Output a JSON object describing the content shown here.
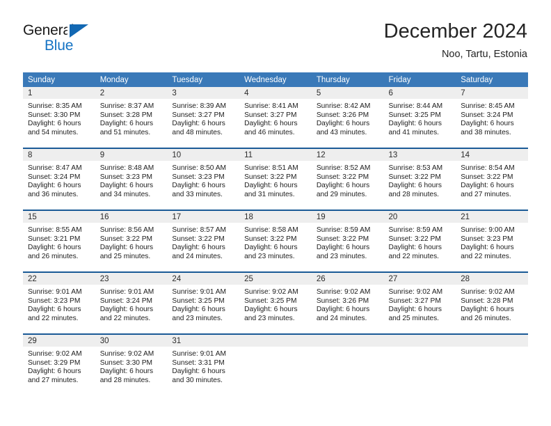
{
  "brand": {
    "name_top": "General",
    "name_bottom": "Blue",
    "color_dark": "#1a1a1a",
    "color_blue": "#1573c4"
  },
  "header": {
    "title": "December 2024",
    "location": "Noo, Tartu, Estonia"
  },
  "theme": {
    "header_row_bg": "#3a79b8",
    "header_row_text": "#ffffff",
    "week_separator": "#1a5a96",
    "daynum_band_bg": "#eeeeee"
  },
  "weekday_headers": [
    "Sunday",
    "Monday",
    "Tuesday",
    "Wednesday",
    "Thursday",
    "Friday",
    "Saturday"
  ],
  "weeks": [
    [
      {
        "day": "1",
        "sunrise": "Sunrise: 8:35 AM",
        "sunset": "Sunset: 3:30 PM",
        "daylight_1": "Daylight: 6 hours",
        "daylight_2": "and 54 minutes."
      },
      {
        "day": "2",
        "sunrise": "Sunrise: 8:37 AM",
        "sunset": "Sunset: 3:28 PM",
        "daylight_1": "Daylight: 6 hours",
        "daylight_2": "and 51 minutes."
      },
      {
        "day": "3",
        "sunrise": "Sunrise: 8:39 AM",
        "sunset": "Sunset: 3:27 PM",
        "daylight_1": "Daylight: 6 hours",
        "daylight_2": "and 48 minutes."
      },
      {
        "day": "4",
        "sunrise": "Sunrise: 8:41 AM",
        "sunset": "Sunset: 3:27 PM",
        "daylight_1": "Daylight: 6 hours",
        "daylight_2": "and 46 minutes."
      },
      {
        "day": "5",
        "sunrise": "Sunrise: 8:42 AM",
        "sunset": "Sunset: 3:26 PM",
        "daylight_1": "Daylight: 6 hours",
        "daylight_2": "and 43 minutes."
      },
      {
        "day": "6",
        "sunrise": "Sunrise: 8:44 AM",
        "sunset": "Sunset: 3:25 PM",
        "daylight_1": "Daylight: 6 hours",
        "daylight_2": "and 41 minutes."
      },
      {
        "day": "7",
        "sunrise": "Sunrise: 8:45 AM",
        "sunset": "Sunset: 3:24 PM",
        "daylight_1": "Daylight: 6 hours",
        "daylight_2": "and 38 minutes."
      }
    ],
    [
      {
        "day": "8",
        "sunrise": "Sunrise: 8:47 AM",
        "sunset": "Sunset: 3:24 PM",
        "daylight_1": "Daylight: 6 hours",
        "daylight_2": "and 36 minutes."
      },
      {
        "day": "9",
        "sunrise": "Sunrise: 8:48 AM",
        "sunset": "Sunset: 3:23 PM",
        "daylight_1": "Daylight: 6 hours",
        "daylight_2": "and 34 minutes."
      },
      {
        "day": "10",
        "sunrise": "Sunrise: 8:50 AM",
        "sunset": "Sunset: 3:23 PM",
        "daylight_1": "Daylight: 6 hours",
        "daylight_2": "and 33 minutes."
      },
      {
        "day": "11",
        "sunrise": "Sunrise: 8:51 AM",
        "sunset": "Sunset: 3:22 PM",
        "daylight_1": "Daylight: 6 hours",
        "daylight_2": "and 31 minutes."
      },
      {
        "day": "12",
        "sunrise": "Sunrise: 8:52 AM",
        "sunset": "Sunset: 3:22 PM",
        "daylight_1": "Daylight: 6 hours",
        "daylight_2": "and 29 minutes."
      },
      {
        "day": "13",
        "sunrise": "Sunrise: 8:53 AM",
        "sunset": "Sunset: 3:22 PM",
        "daylight_1": "Daylight: 6 hours",
        "daylight_2": "and 28 minutes."
      },
      {
        "day": "14",
        "sunrise": "Sunrise: 8:54 AM",
        "sunset": "Sunset: 3:22 PM",
        "daylight_1": "Daylight: 6 hours",
        "daylight_2": "and 27 minutes."
      }
    ],
    [
      {
        "day": "15",
        "sunrise": "Sunrise: 8:55 AM",
        "sunset": "Sunset: 3:21 PM",
        "daylight_1": "Daylight: 6 hours",
        "daylight_2": "and 26 minutes."
      },
      {
        "day": "16",
        "sunrise": "Sunrise: 8:56 AM",
        "sunset": "Sunset: 3:22 PM",
        "daylight_1": "Daylight: 6 hours",
        "daylight_2": "and 25 minutes."
      },
      {
        "day": "17",
        "sunrise": "Sunrise: 8:57 AM",
        "sunset": "Sunset: 3:22 PM",
        "daylight_1": "Daylight: 6 hours",
        "daylight_2": "and 24 minutes."
      },
      {
        "day": "18",
        "sunrise": "Sunrise: 8:58 AM",
        "sunset": "Sunset: 3:22 PM",
        "daylight_1": "Daylight: 6 hours",
        "daylight_2": "and 23 minutes."
      },
      {
        "day": "19",
        "sunrise": "Sunrise: 8:59 AM",
        "sunset": "Sunset: 3:22 PM",
        "daylight_1": "Daylight: 6 hours",
        "daylight_2": "and 23 minutes."
      },
      {
        "day": "20",
        "sunrise": "Sunrise: 8:59 AM",
        "sunset": "Sunset: 3:22 PM",
        "daylight_1": "Daylight: 6 hours",
        "daylight_2": "and 22 minutes."
      },
      {
        "day": "21",
        "sunrise": "Sunrise: 9:00 AM",
        "sunset": "Sunset: 3:23 PM",
        "daylight_1": "Daylight: 6 hours",
        "daylight_2": "and 22 minutes."
      }
    ],
    [
      {
        "day": "22",
        "sunrise": "Sunrise: 9:01 AM",
        "sunset": "Sunset: 3:23 PM",
        "daylight_1": "Daylight: 6 hours",
        "daylight_2": "and 22 minutes."
      },
      {
        "day": "23",
        "sunrise": "Sunrise: 9:01 AM",
        "sunset": "Sunset: 3:24 PM",
        "daylight_1": "Daylight: 6 hours",
        "daylight_2": "and 22 minutes."
      },
      {
        "day": "24",
        "sunrise": "Sunrise: 9:01 AM",
        "sunset": "Sunset: 3:25 PM",
        "daylight_1": "Daylight: 6 hours",
        "daylight_2": "and 23 minutes."
      },
      {
        "day": "25",
        "sunrise": "Sunrise: 9:02 AM",
        "sunset": "Sunset: 3:25 PM",
        "daylight_1": "Daylight: 6 hours",
        "daylight_2": "and 23 minutes."
      },
      {
        "day": "26",
        "sunrise": "Sunrise: 9:02 AM",
        "sunset": "Sunset: 3:26 PM",
        "daylight_1": "Daylight: 6 hours",
        "daylight_2": "and 24 minutes."
      },
      {
        "day": "27",
        "sunrise": "Sunrise: 9:02 AM",
        "sunset": "Sunset: 3:27 PM",
        "daylight_1": "Daylight: 6 hours",
        "daylight_2": "and 25 minutes."
      },
      {
        "day": "28",
        "sunrise": "Sunrise: 9:02 AM",
        "sunset": "Sunset: 3:28 PM",
        "daylight_1": "Daylight: 6 hours",
        "daylight_2": "and 26 minutes."
      }
    ],
    [
      {
        "day": "29",
        "sunrise": "Sunrise: 9:02 AM",
        "sunset": "Sunset: 3:29 PM",
        "daylight_1": "Daylight: 6 hours",
        "daylight_2": "and 27 minutes."
      },
      {
        "day": "30",
        "sunrise": "Sunrise: 9:02 AM",
        "sunset": "Sunset: 3:30 PM",
        "daylight_1": "Daylight: 6 hours",
        "daylight_2": "and 28 minutes."
      },
      {
        "day": "31",
        "sunrise": "Sunrise: 9:01 AM",
        "sunset": "Sunset: 3:31 PM",
        "daylight_1": "Daylight: 6 hours",
        "daylight_2": "and 30 minutes."
      },
      {
        "day": "",
        "sunrise": "",
        "sunset": "",
        "daylight_1": "",
        "daylight_2": "",
        "empty": true
      },
      {
        "day": "",
        "sunrise": "",
        "sunset": "",
        "daylight_1": "",
        "daylight_2": "",
        "empty": true
      },
      {
        "day": "",
        "sunrise": "",
        "sunset": "",
        "daylight_1": "",
        "daylight_2": "",
        "empty": true
      },
      {
        "day": "",
        "sunrise": "",
        "sunset": "",
        "daylight_1": "",
        "daylight_2": "",
        "empty": true
      }
    ]
  ]
}
